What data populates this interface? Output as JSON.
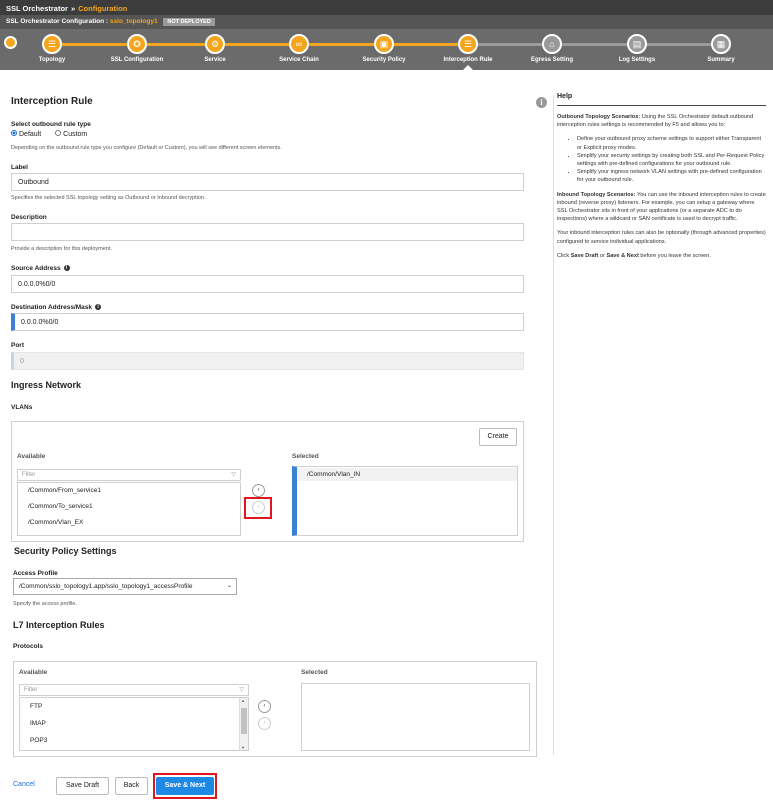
{
  "header": {
    "app": "SSL Orchestrator",
    "sep": "»",
    "section": "Configuration",
    "config_label": "SSL Orchestrator Configuration :",
    "topology": "sslo_topology1",
    "status": "NOT DEPLOYED"
  },
  "wizard": {
    "steps": [
      {
        "label": "Topology",
        "icon": "list-icon"
      },
      {
        "label": "SSL Configuration",
        "icon": "certificate-icon"
      },
      {
        "label": "Service",
        "icon": "gears-icon"
      },
      {
        "label": "Service Chain",
        "icon": "link-icon"
      },
      {
        "label": "Security Policy",
        "icon": "lock-icon"
      },
      {
        "label": "Interception Rule",
        "icon": "list-icon"
      },
      {
        "label": "Egress Setting",
        "icon": "network-icon"
      },
      {
        "label": "Log Settings",
        "icon": "log-icon"
      },
      {
        "label": "Summary",
        "icon": "summary-icon"
      }
    ],
    "current_index": 5,
    "completed_color": "#f4a51c",
    "pending_color": "#9a9a9a"
  },
  "form": {
    "title": "Interception Rule",
    "rule_type": {
      "label": "Select outbound rule type",
      "options": [
        "Default",
        "Custom"
      ],
      "selected": "Default",
      "hint": "Depending on the outbound rule type you configure (Default or Custom), you will see different screen elements."
    },
    "label_field": {
      "label": "Label",
      "value": "Outbound",
      "hint": "Specifies the selected SSL topology setting as Outbound or Inbound decryption."
    },
    "description_field": {
      "label": "Description",
      "value": "",
      "hint": "Provide a description for this deployment."
    },
    "source_address": {
      "label": "Source Address",
      "value": "0.0.0.0%0/0"
    },
    "destination_address": {
      "label": "Destination Address/Mask",
      "value": "0.0.0.0%0/0"
    },
    "port": {
      "label": "Port",
      "value": "0"
    }
  },
  "ingress": {
    "title": "Ingress Network",
    "vlans_label": "VLANs",
    "create_label": "Create",
    "available_label": "Available",
    "selected_label": "Selected",
    "filter_placeholder": "Filter",
    "available": [
      "/Common/From_service1",
      "/Common/To_service1",
      "/Common/Vlan_EX"
    ],
    "selected": [
      "/Common/Vlan_IN"
    ]
  },
  "security_policy": {
    "title": "Security Policy Settings",
    "access_profile_label": "Access Profile",
    "access_profile_value": "/Common/sslo_topology1.app/sslo_topology1_accessProfile",
    "hint": "Specify the access profile."
  },
  "l7": {
    "title": "L7 Interception Rules",
    "protocols_label": "Protocols",
    "available_label": "Available",
    "selected_label": "Selected",
    "filter_placeholder": "Filter",
    "available": [
      "FTP",
      "IMAP",
      "POP3"
    ]
  },
  "footer": {
    "cancel": "Cancel",
    "save_draft": "Save Draft",
    "back": "Back",
    "save_next": "Save & Next"
  },
  "help": {
    "title": "Help",
    "p1_label": "Outbound Topology Scenarios:",
    "p1_text": "Using the SSL Orchestrator default outbound interception rules settings is recommended by F5 and allows you to:",
    "bullets": [
      "Define your outbound proxy scheme settings to support either Transparent or Explicit proxy modes.",
      "Simplify your security settings by creating both SSL and Per-Request Policy settings with pre-defined configurations for your outbound rule.",
      "Simplify your ingress network VLAN settings with pre-defined configuration for your outbound rule."
    ],
    "p2_label": "Inbound Topology Scenarios:",
    "p2_text": "You can use the inbound interception rules to create inbound (reverse proxy) listeners. For example, you can setup a gateway where SSL Orchestrator sits in front of your applications (or a separate ADC to do inspections) where a wildcard or SAN certificate is used to decrypt traffic.",
    "p3": "Your inbound interception rules can also be optionally (through advanced properties) configured to service individual applications.",
    "p4_pre": "Click",
    "p4_save_draft": "Save Draft",
    "p4_or": "or",
    "p4_save_next": "Save & Next",
    "p4_post": "before you leave the screen."
  }
}
